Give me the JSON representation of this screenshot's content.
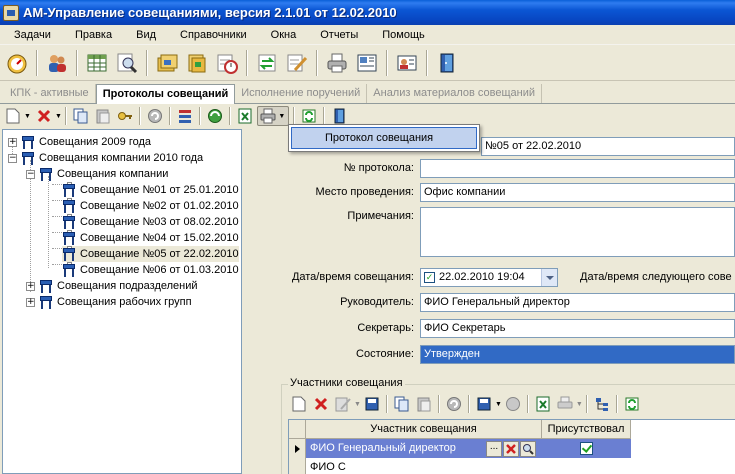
{
  "window": {
    "title": "АМ-Управление совещаниями, версия 2.1.01 от 12.02.2010"
  },
  "menu": [
    "Задачи",
    "Правка",
    "Вид",
    "Справочники",
    "Окна",
    "Отчеты",
    "Помощь"
  ],
  "tabs": [
    {
      "label": "КПК - активные",
      "active": false
    },
    {
      "label": "Протоколы совещаний",
      "active": true
    },
    {
      "label": "Исполнение поручений",
      "active": false
    },
    {
      "label": "Анализ материалов совещаний",
      "active": false
    }
  ],
  "popup": {
    "item": "Протокол совещания"
  },
  "tree": {
    "nodes": [
      {
        "label": "Совещания 2009 года",
        "level": 0,
        "expander": "+"
      },
      {
        "label": "Совещания компании 2010 года",
        "level": 0,
        "expander": "−"
      },
      {
        "label": "Совещания компании",
        "level": 1,
        "expander": "−"
      },
      {
        "label": "Совещание №01 от 25.01.2010",
        "level": 2,
        "expander": ""
      },
      {
        "label": "Совещание №02 от 01.02.2010",
        "level": 2,
        "expander": ""
      },
      {
        "label": "Совещание №03 от 08.02.2010",
        "level": 2,
        "expander": ""
      },
      {
        "label": "Совещание №04 от 15.02.2010",
        "level": 2,
        "expander": ""
      },
      {
        "label": "Совещание №05 от 22.02.2010",
        "level": 2,
        "expander": "",
        "selected": true
      },
      {
        "label": "Совещание №06 от 01.03.2010",
        "level": 2,
        "expander": ""
      },
      {
        "label": "Совещания подразделений",
        "level": 1,
        "expander": "+"
      },
      {
        "label": "Совещания рабочих групп",
        "level": 1,
        "expander": "+"
      }
    ]
  },
  "form": {
    "name_value": "№05 от 22.02.2010",
    "protocol_label": "№ протокола:",
    "protocol_value": "",
    "place_label": "Место проведения:",
    "place_value": "Офис компании",
    "notes_label": "Примечания:",
    "notes_value": "",
    "datetime_label": "Дата/время совещания:",
    "datetime_value": "22.02.2010 19:04",
    "next_datetime_label": "Дата/время следующего сове",
    "leader_label": "Руководитель:",
    "leader_value": "ФИО Генеральный директор",
    "secretary_label": "Секретарь:",
    "secretary_value": "ФИО Секретарь",
    "state_label": "Состояние:",
    "state_value": "Утвержден"
  },
  "participants": {
    "title": "Участники совещания",
    "columns": [
      "Участник совещания",
      "Присутствовал"
    ],
    "rows": [
      {
        "name": "ФИО Генеральный директор",
        "present": true
      },
      {
        "name": "ФИО С",
        "present": false
      }
    ],
    "ellipsis": "..."
  }
}
